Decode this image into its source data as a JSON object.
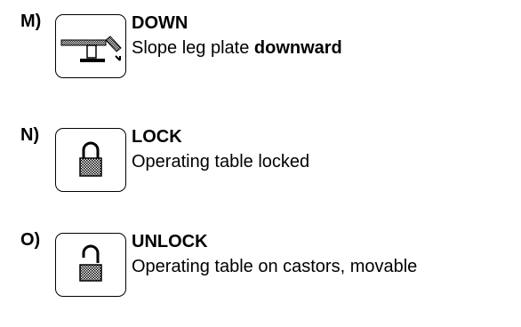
{
  "items": [
    {
      "letter": "M)",
      "title": "DOWN",
      "description_prefix": "Slope leg plate ",
      "description_bold": "downward",
      "icon": "slope-leg-plate-down-icon"
    },
    {
      "letter": "N)",
      "title": "LOCK",
      "description": "Operating table locked",
      "icon": "padlock-closed-icon"
    },
    {
      "letter": "O)",
      "title": "UNLOCK",
      "description": "Operating table on castors, movable",
      "icon": "padlock-open-icon"
    }
  ]
}
